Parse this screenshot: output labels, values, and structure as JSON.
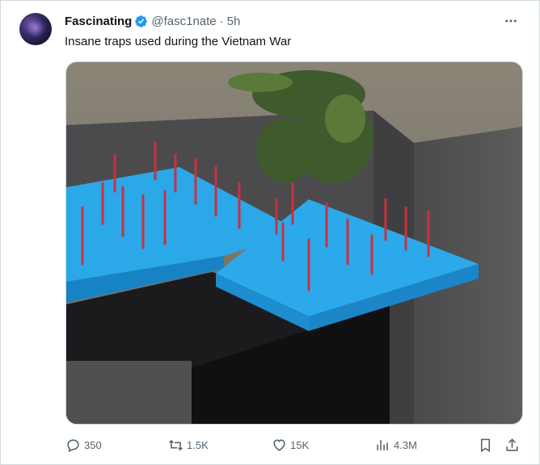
{
  "author": {
    "display_name": "Fascinating",
    "handle": "@fasc1nate",
    "separator": "·",
    "time": "5h"
  },
  "tweet": {
    "text": "Insane traps used during the Vietnam War"
  },
  "actions": {
    "replies": "350",
    "reposts": "1.5K",
    "likes": "15K",
    "views": "4.3M"
  },
  "colors": {
    "verified": "#1d9bf0",
    "icon_gray": "#536471",
    "trap_blue": "#27a7e7"
  },
  "icons": [
    "verified-badge-icon",
    "more-icon",
    "reply-icon",
    "repost-icon",
    "like-icon",
    "views-icon",
    "bookmark-icon",
    "share-icon"
  ]
}
